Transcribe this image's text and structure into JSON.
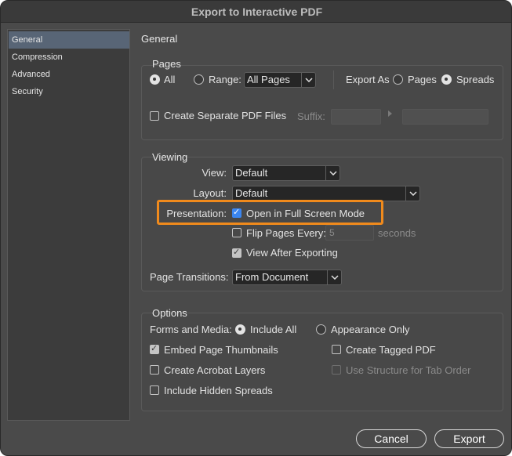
{
  "window": {
    "title": "Export to Interactive PDF"
  },
  "sidebar": {
    "items": [
      {
        "label": "General",
        "selected": true
      },
      {
        "label": "Compression",
        "selected": false
      },
      {
        "label": "Advanced",
        "selected": false
      },
      {
        "label": "Security",
        "selected": false
      }
    ]
  },
  "section_title": "General",
  "pages": {
    "title": "Pages",
    "all_label": "All",
    "range_label": "Range:",
    "range_value": "All Pages",
    "export_as_label": "Export As",
    "pages_label": "Pages",
    "spreads_label": "Spreads",
    "selected": "All",
    "export_as_selected": "Spreads",
    "create_separate_label": "Create Separate PDF Files",
    "create_separate_checked": false,
    "suffix_label": "Suffix:"
  },
  "viewing": {
    "title": "Viewing",
    "view_label": "View:",
    "view_value": "Default",
    "layout_label": "Layout:",
    "layout_value": "Default",
    "presentation_label": "Presentation:",
    "full_screen_label": "Open in Full Screen Mode",
    "full_screen_checked": true,
    "flip_label": "Flip Pages Every:",
    "flip_checked": false,
    "flip_value": "5",
    "seconds_label": "seconds",
    "view_after_label": "View After Exporting",
    "view_after_checked": true,
    "transitions_label": "Page Transitions:",
    "transitions_value": "From Document"
  },
  "options": {
    "title": "Options",
    "forms_label": "Forms and Media:",
    "include_all_label": "Include All",
    "appearance_only_label": "Appearance Only",
    "forms_selected": "Include All",
    "embed_thumbnails_label": "Embed Page Thumbnails",
    "embed_thumbnails_checked": true,
    "tagged_pdf_label": "Create Tagged PDF",
    "tagged_pdf_checked": false,
    "acrobat_layers_label": "Create Acrobat Layers",
    "acrobat_layers_checked": false,
    "structure_tab_label": "Use Structure for Tab Order",
    "structure_tab_checked": false,
    "hidden_spreads_label": "Include Hidden Spreads",
    "hidden_spreads_checked": false
  },
  "buttons": {
    "cancel": "Cancel",
    "export": "Export"
  },
  "colors": {
    "accent": "#3b86f0",
    "highlight": "#f08a1c",
    "selection": "#586576"
  }
}
